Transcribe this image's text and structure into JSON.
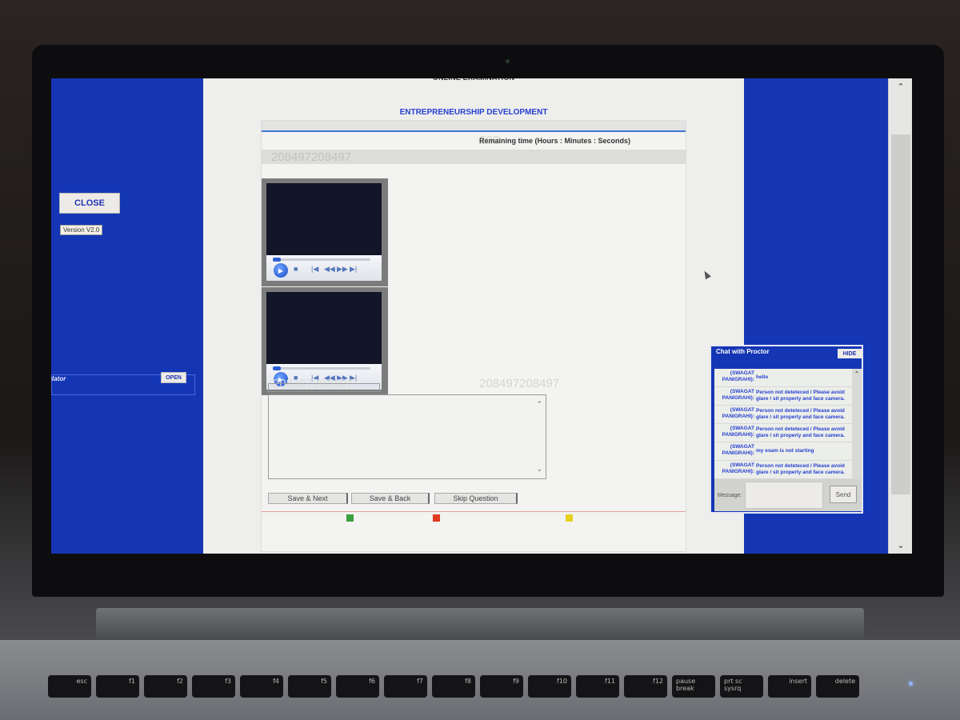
{
  "exam": {
    "title": "ONLINE EXAMINATION",
    "subject": "ENTREPRENEURSHIP DEVELOPMENT",
    "timer_label": "Remaining time (Hours : Minutes : Seconds)",
    "question_id": "208497208497",
    "ghost_id_top": "208",
    "ghost_id_answer": "208497208497",
    "ghost_id_answer_right": "208497208497"
  },
  "left_panel": {
    "close_label": "CLOSE",
    "version_label": "Version V2.0",
    "calculator_label": "ulator",
    "open_label": "OPEN"
  },
  "players": [
    {
      "name": "video-player-1",
      "progress": 0.08
    },
    {
      "name": "video-player-2",
      "progress": 0.08
    }
  ],
  "player_controls": {
    "play": "▶",
    "stop": "■",
    "prev": "|◀",
    "rewind": "◀◀",
    "forward": "▶▶",
    "next": "▶|"
  },
  "actions": {
    "save_next": "Save & Next",
    "save_back": "Save & Back",
    "skip": "Skip Question"
  },
  "legend": {
    "colors": [
      "#3aa040",
      "#e03a20",
      "#e8d020"
    ],
    "labels": [
      "",
      "",
      ""
    ]
  },
  "chat": {
    "title": "Chat with Proctor",
    "hide_label": "HIDE",
    "message_label": "Message:",
    "send_label": "Send",
    "messages": [
      {
        "sender": "(SWAGAT PANIGRAHI):",
        "text": "hello"
      },
      {
        "sender": "(SWAGAT PANIGRAHI):",
        "text": "Person not deteteced / Please avoid glare / sit properly and face camera."
      },
      {
        "sender": "(SWAGAT PANIGRAHI):",
        "text": "Person not deteteced / Please avoid glare / sit properly and face camera."
      },
      {
        "sender": "(SWAGAT PANIGRAHI):",
        "text": "Person not deteteced / Please avoid glare / sit properly and face camera."
      },
      {
        "sender": "(SWAGAT PANIGRAHI):",
        "text": "my exam is not starting"
      },
      {
        "sender": "(SWAGAT PANIGRAHI):",
        "text": "Person not deteteced / Please avoid glare / sit properly and face camera."
      }
    ]
  },
  "icons": {
    "scroll_up": "⌃",
    "scroll_down": "⌄"
  },
  "keyboard": {
    "keys": [
      "esc",
      "f1",
      "f2",
      "f3",
      "f4",
      "f5",
      "f6",
      "f7",
      "f8",
      "f9",
      "f10",
      "f11",
      "f12",
      "pause break",
      "prt sc sysrq",
      "insert",
      "delete"
    ]
  }
}
